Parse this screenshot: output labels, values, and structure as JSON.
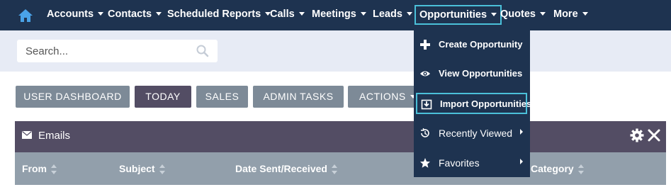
{
  "nav": {
    "home_icon": "home-icon",
    "items": [
      {
        "label": "Accounts"
      },
      {
        "label": "Contacts"
      },
      {
        "label": "Scheduled Reports"
      },
      {
        "label": "Calls"
      },
      {
        "label": "Meetings"
      },
      {
        "label": "Leads"
      },
      {
        "label": "Opportunities"
      },
      {
        "label": "Quotes"
      },
      {
        "label": "More"
      }
    ]
  },
  "search": {
    "placeholder": "Search...",
    "value": ""
  },
  "tabs": [
    {
      "label": "USER DASHBOARD"
    },
    {
      "label": "TODAY"
    },
    {
      "label": "SALES"
    },
    {
      "label": "ADMIN TASKS"
    },
    {
      "label": "ACTIONS"
    }
  ],
  "dashlet": {
    "title": "Emails",
    "columns": [
      {
        "label": "From"
      },
      {
        "label": "Subject"
      },
      {
        "label": "Date Sent/Received"
      },
      {
        "label": "Category"
      }
    ]
  },
  "dropdown": {
    "items": [
      {
        "label": "Create Opportunity",
        "icon": "plus-icon"
      },
      {
        "label": "View Opportunities",
        "icon": "eye-icon"
      },
      {
        "label": "Import Opportunities",
        "icon": "import-icon"
      },
      {
        "label": "Recently Viewed",
        "icon": "history-icon"
      },
      {
        "label": "Favorites",
        "icon": "star-icon"
      }
    ]
  },
  "colors": {
    "nav_bg": "#1e3350",
    "accent_focus": "#4bc0d9",
    "dashlet_header": "#534d64",
    "column_header": "#929fab",
    "tab_bg": "#7d8a97"
  }
}
